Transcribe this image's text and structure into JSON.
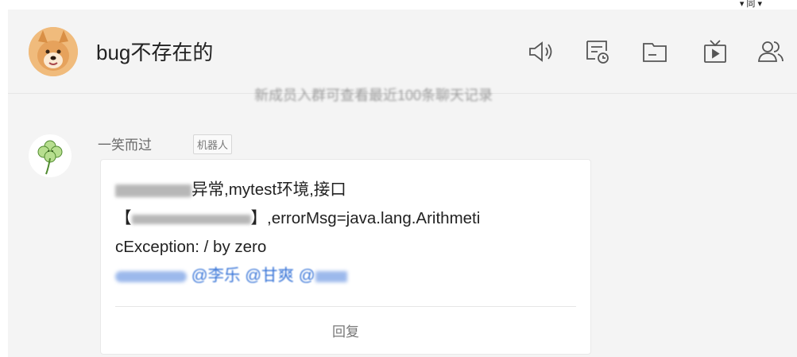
{
  "chat": {
    "title": "bug不存在的"
  },
  "header_icons": [
    "announcement-icon",
    "chat-history-icon",
    "files-icon",
    "live-icon",
    "members-icon"
  ],
  "notice": {
    "text": "新成员入群可查看最近100条聊天记录"
  },
  "message": {
    "sender": "一笑而过",
    "badge": "机器人",
    "text_part1": "异常,mytest环境,接口",
    "bracket_open": "【",
    "bracket_close": "】",
    "text_part2": ",errorMsg=java.lang.Arithmeti",
    "text_part3": "cException: / by zero",
    "mentions": [
      "@李乐",
      "@甘爽",
      "@"
    ],
    "reply_label": "回复"
  },
  "colors": {
    "mention": "#3a76d8",
    "panel_bg": "#f4f4f4"
  }
}
